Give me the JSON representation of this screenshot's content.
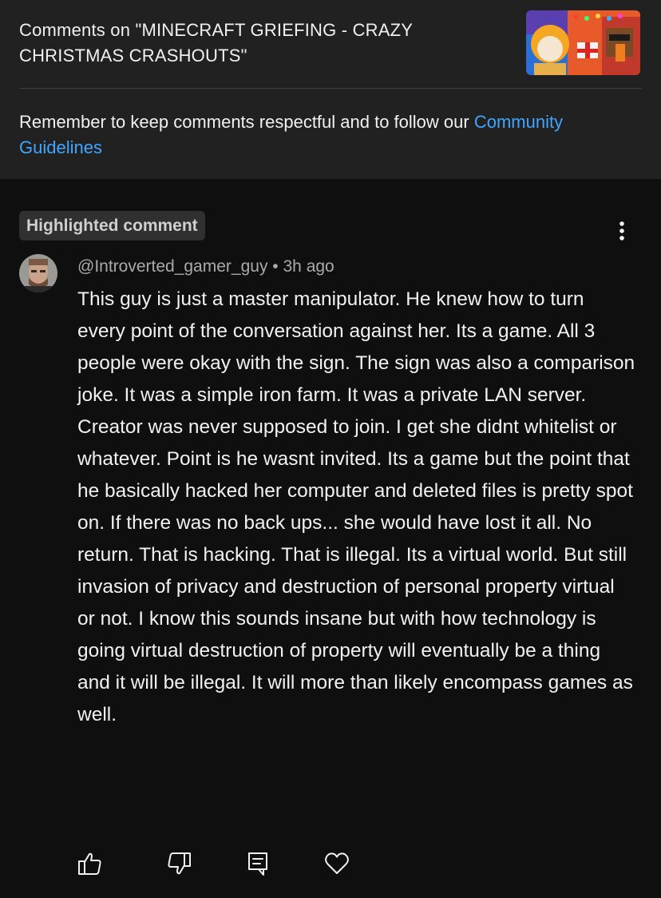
{
  "header": {
    "title": "Comments on \"MINECRAFT GRIEFING - CRAZY CHRISTMAS CRASHOUTS\"",
    "thumbnail_icon": "video-thumbnail",
    "reminder_text": "Remember to keep comments respectful and to follow our ",
    "guidelines_link": "Community Guidelines",
    "link_color": "#3ea6ff"
  },
  "comment": {
    "badge": "Highlighted comment",
    "author": "@Introverted_gamer_guy",
    "separator": "•",
    "time": "3h ago",
    "text": "This guy is just a master manipulator. He knew how to turn every point of the conversation against her. Its a game. All 3 people were okay with the sign. The sign was also a comparison joke. It was a simple iron farm. It was a private LAN server. Creator was never supposed to join. I get she didnt whitelist or whatever. Point is he wasnt invited. Its a game but the point that he basically hacked her computer and deleted files is pretty spot on. If there was no back ups... she would have lost it all. No return. That is hacking. That is illegal. Its a virtual world. But still invasion of privacy and destruction of personal property virtual or not. I know this sounds insane but with how technology is going virtual destruction of property will eventually be a thing and it will be illegal. It will more than likely encompass games as well.",
    "menu_icon": "more-vertical-icon",
    "actions": [
      "thumbs-up-icon",
      "thumbs-down-icon",
      "reply-icon",
      "heart-icon"
    ]
  },
  "colors": {
    "header_bg": "#212121",
    "page_bg": "#0f0f0f",
    "badge_bg": "#303030"
  }
}
